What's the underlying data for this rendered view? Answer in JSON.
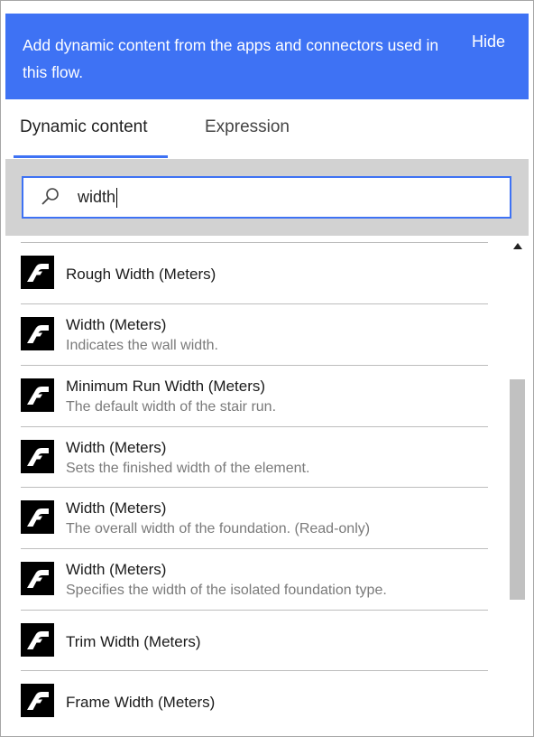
{
  "banner": {
    "message": "Add dynamic content from the apps and connectors used in this flow.",
    "hide_label": "Hide",
    "color": "#3e72f4"
  },
  "tabs": [
    {
      "label": "Dynamic content",
      "active": true
    },
    {
      "label": "Expression",
      "active": false
    }
  ],
  "search": {
    "value": "width",
    "icon": "search-icon"
  },
  "items": [
    {
      "title": "Rough Width (Meters)",
      "description": ""
    },
    {
      "title": "Width (Meters)",
      "description": "Indicates the wall width."
    },
    {
      "title": "Minimum Run Width (Meters)",
      "description": "The default width of the stair run."
    },
    {
      "title": "Width (Meters)",
      "description": "Sets the finished width of the element."
    },
    {
      "title": "Width (Meters)",
      "description": "The overall width of the foundation. (Read-only)"
    },
    {
      "title": "Width (Meters)",
      "description": "Specifies the width of the isolated foundation type."
    },
    {
      "title": "Trim Width (Meters)",
      "description": ""
    },
    {
      "title": "Frame Width (Meters)",
      "description": ""
    }
  ],
  "item_icon": "autodesk-logo-icon"
}
